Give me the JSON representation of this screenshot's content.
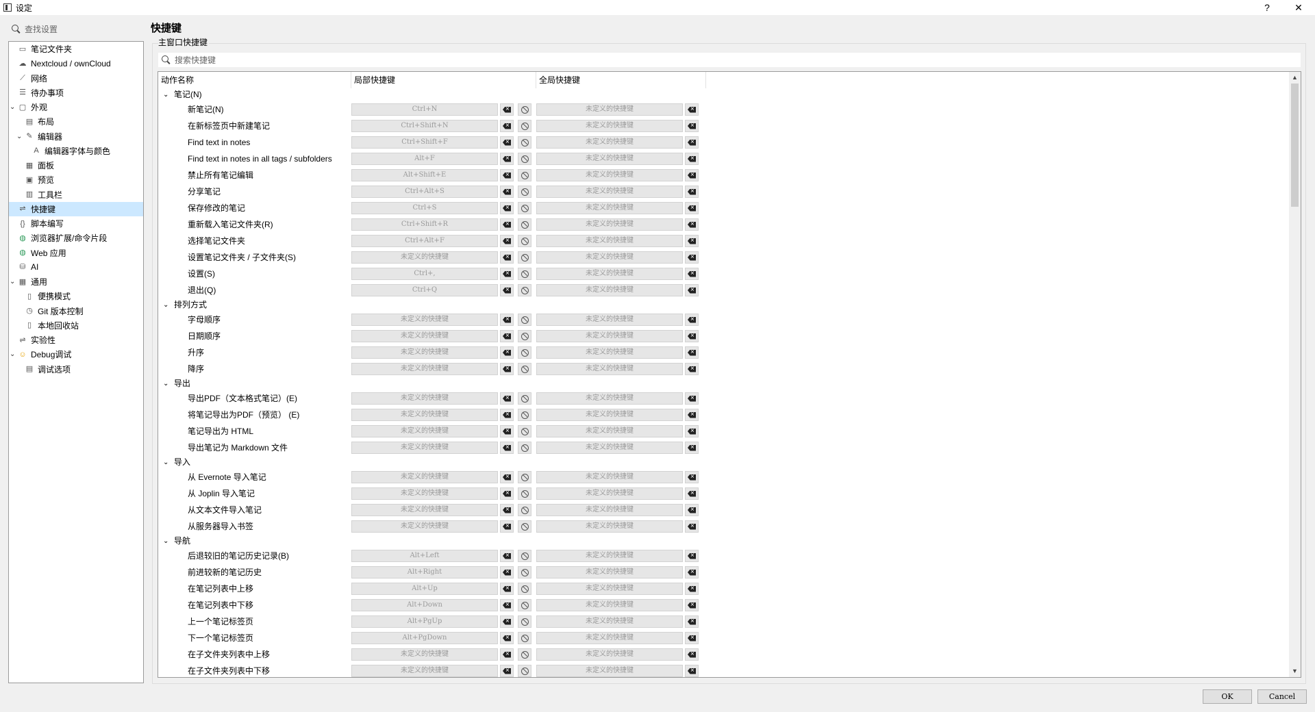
{
  "window": {
    "title": "设定",
    "help": "?",
    "close": "✕"
  },
  "left_search": {
    "placeholder": "查找设置"
  },
  "tree": [
    {
      "label": "笔记文件夹",
      "icon": "folder-icon",
      "depth": 0
    },
    {
      "label": "Nextcloud / ownCloud",
      "icon": "cloud-icon",
      "depth": 0
    },
    {
      "label": "网络",
      "icon": "network-icon",
      "depth": 0
    },
    {
      "label": "待办事项",
      "icon": "todo-icon",
      "depth": 0
    },
    {
      "label": "外观",
      "icon": "appearance-icon",
      "depth": 0,
      "expanded": true
    },
    {
      "label": "布局",
      "icon": "layout-icon",
      "depth": 1
    },
    {
      "label": "编辑器",
      "icon": "editor-icon",
      "depth": 1,
      "expanded": true
    },
    {
      "label": "编辑器字体与颜色",
      "icon": "font-icon",
      "depth": 2
    },
    {
      "label": "面板",
      "icon": "panel-icon",
      "depth": 1
    },
    {
      "label": "预览",
      "icon": "preview-icon",
      "depth": 1
    },
    {
      "label": "工具栏",
      "icon": "toolbar-icon",
      "depth": 1
    },
    {
      "label": "快捷键",
      "icon": "shortcut-icon",
      "depth": 0,
      "selected": true
    },
    {
      "label": "脚本编写",
      "icon": "script-icon",
      "depth": 0
    },
    {
      "label": "浏览器扩展/命令片段",
      "icon": "globe-icon",
      "depth": 0
    },
    {
      "label": "Web 应用",
      "icon": "globe-icon",
      "depth": 0
    },
    {
      "label": "AI",
      "icon": "database-icon",
      "depth": 0
    },
    {
      "label": "通用",
      "icon": "general-icon",
      "depth": 0,
      "expanded": true
    },
    {
      "label": "便携模式",
      "icon": "portable-icon",
      "depth": 1
    },
    {
      "label": "Git 版本控制",
      "icon": "clock-icon",
      "depth": 1
    },
    {
      "label": "本地回收站",
      "icon": "trash-icon",
      "depth": 1
    },
    {
      "label": "实验性",
      "icon": "experimental-icon",
      "depth": 0
    },
    {
      "label": "Debug调试",
      "icon": "smiley-icon",
      "depth": 0,
      "expanded": true
    },
    {
      "label": "调试选项",
      "icon": "debug-options-icon",
      "depth": 1
    }
  ],
  "page_title": "快捷键",
  "section_label": "主窗口快捷键",
  "shortcut_search": {
    "placeholder": "搜索快捷键"
  },
  "table": {
    "columns": [
      "动作名称",
      "局部快捷键",
      "全局快捷键"
    ],
    "undefined_text": "未定义的快捷键",
    "rows": [
      {
        "type": "group",
        "label": "笔记(N)"
      },
      {
        "type": "action",
        "label": "新笔记(N)",
        "local": "Ctrl+N",
        "global": "未定义的快捷键"
      },
      {
        "type": "action",
        "label": "在新标签页中新建笔记",
        "local": "Ctrl+Shift+N",
        "global": "未定义的快捷键"
      },
      {
        "type": "action",
        "label": "Find text in notes",
        "local": "Ctrl+Shift+F",
        "global": "未定义的快捷键"
      },
      {
        "type": "action",
        "label": "Find text in notes in all tags / subfolders",
        "local": "Alt+F",
        "global": "未定义的快捷键"
      },
      {
        "type": "action",
        "label": "禁止所有笔记编辑",
        "local": "Alt+Shift+E",
        "global": "未定义的快捷键"
      },
      {
        "type": "action",
        "label": "分享笔记",
        "local": "Ctrl+Alt+S",
        "global": "未定义的快捷键"
      },
      {
        "type": "action",
        "label": "保存修改的笔记",
        "local": "Ctrl+S",
        "global": "未定义的快捷键"
      },
      {
        "type": "action",
        "label": "重新载入笔记文件夹(R)",
        "local": "Ctrl+Shift+R",
        "global": "未定义的快捷键"
      },
      {
        "type": "action",
        "label": "选择笔记文件夹",
        "local": "Ctrl+Alt+F",
        "global": "未定义的快捷键"
      },
      {
        "type": "action",
        "label": "设置笔记文件夹 / 子文件夹(S)",
        "local": "未定义的快捷键",
        "global": "未定义的快捷键"
      },
      {
        "type": "action",
        "label": "设置(S)",
        "local": "Ctrl+,",
        "global": "未定义的快捷键"
      },
      {
        "type": "action",
        "label": "退出(Q)",
        "local": "Ctrl+Q",
        "global": "未定义的快捷键"
      },
      {
        "type": "group",
        "label": "排列方式"
      },
      {
        "type": "action",
        "label": "字母顺序",
        "local": "未定义的快捷键",
        "global": "未定义的快捷键"
      },
      {
        "type": "action",
        "label": "日期顺序",
        "local": "未定义的快捷键",
        "global": "未定义的快捷键"
      },
      {
        "type": "action",
        "label": "升序",
        "local": "未定义的快捷键",
        "global": "未定义的快捷键"
      },
      {
        "type": "action",
        "label": "降序",
        "local": "未定义的快捷键",
        "global": "未定义的快捷键"
      },
      {
        "type": "group",
        "label": "导出"
      },
      {
        "type": "action",
        "label": "导出PDF（文本格式笔记）(E)",
        "local": "未定义的快捷键",
        "global": "未定义的快捷键"
      },
      {
        "type": "action",
        "label": "将笔记导出为PDF（预览） (E)",
        "local": "未定义的快捷键",
        "global": "未定义的快捷键"
      },
      {
        "type": "action",
        "label": "笔记导出为 HTML",
        "local": "未定义的快捷键",
        "global": "未定义的快捷键"
      },
      {
        "type": "action",
        "label": "导出笔记为 Markdown 文件",
        "local": "未定义的快捷键",
        "global": "未定义的快捷键"
      },
      {
        "type": "group",
        "label": "导入"
      },
      {
        "type": "action",
        "label": "从 Evernote 导入笔记",
        "local": "未定义的快捷键",
        "global": "未定义的快捷键"
      },
      {
        "type": "action",
        "label": "从 Joplin 导入笔记",
        "local": "未定义的快捷键",
        "global": "未定义的快捷键"
      },
      {
        "type": "action",
        "label": "从文本文件导入笔记",
        "local": "未定义的快捷键",
        "global": "未定义的快捷键"
      },
      {
        "type": "action",
        "label": "从服务器导入书签",
        "local": "未定义的快捷键",
        "global": "未定义的快捷键"
      },
      {
        "type": "group",
        "label": "导航"
      },
      {
        "type": "action",
        "label": "后退较旧的笔记历史记录(B)",
        "local": "Alt+Left",
        "global": "未定义的快捷键"
      },
      {
        "type": "action",
        "label": "前进较新的笔记历史",
        "local": "Alt+Right",
        "global": "未定义的快捷键"
      },
      {
        "type": "action",
        "label": "在笔记列表中上移",
        "local": "Alt+Up",
        "global": "未定义的快捷键"
      },
      {
        "type": "action",
        "label": "在笔记列表中下移",
        "local": "Alt+Down",
        "global": "未定义的快捷键"
      },
      {
        "type": "action",
        "label": "上一个笔记标签页",
        "local": "Alt+PgUp",
        "global": "未定义的快捷键"
      },
      {
        "type": "action",
        "label": "下一个笔记标签页",
        "local": "Alt+PgDown",
        "global": "未定义的快捷键"
      },
      {
        "type": "action",
        "label": "在子文件夹列表中上移",
        "local": "未定义的快捷键",
        "global": "未定义的快捷键"
      },
      {
        "type": "action",
        "label": "在子文件夹列表中下移",
        "local": "未定义的快捷键",
        "global": "未定义的快捷键"
      }
    ]
  },
  "buttons": {
    "ok": "OK",
    "cancel": "Cancel"
  }
}
